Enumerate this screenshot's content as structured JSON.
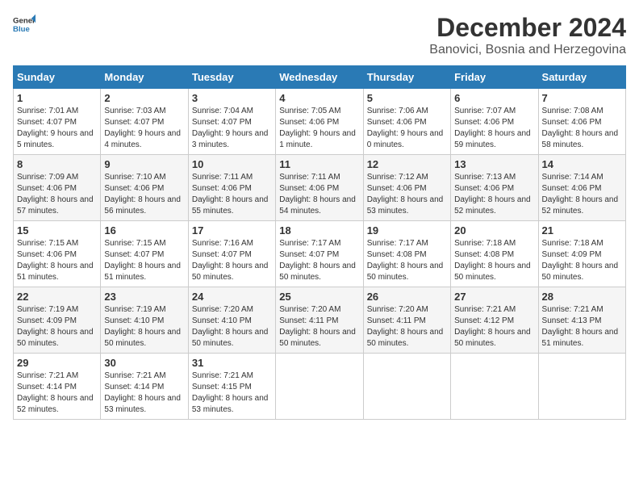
{
  "logo": {
    "general": "General",
    "blue": "Blue"
  },
  "title": "December 2024",
  "location": "Banovici, Bosnia and Herzegovina",
  "days_of_week": [
    "Sunday",
    "Monday",
    "Tuesday",
    "Wednesday",
    "Thursday",
    "Friday",
    "Saturday"
  ],
  "weeks": [
    [
      {
        "day": "1",
        "sunrise": "7:01 AM",
        "sunset": "4:07 PM",
        "daylight": "9 hours and 5 minutes."
      },
      {
        "day": "2",
        "sunrise": "7:03 AM",
        "sunset": "4:07 PM",
        "daylight": "9 hours and 4 minutes."
      },
      {
        "day": "3",
        "sunrise": "7:04 AM",
        "sunset": "4:07 PM",
        "daylight": "9 hours and 3 minutes."
      },
      {
        "day": "4",
        "sunrise": "7:05 AM",
        "sunset": "4:06 PM",
        "daylight": "9 hours and 1 minute."
      },
      {
        "day": "5",
        "sunrise": "7:06 AM",
        "sunset": "4:06 PM",
        "daylight": "9 hours and 0 minutes."
      },
      {
        "day": "6",
        "sunrise": "7:07 AM",
        "sunset": "4:06 PM",
        "daylight": "8 hours and 59 minutes."
      },
      {
        "day": "7",
        "sunrise": "7:08 AM",
        "sunset": "4:06 PM",
        "daylight": "8 hours and 58 minutes."
      }
    ],
    [
      {
        "day": "8",
        "sunrise": "7:09 AM",
        "sunset": "4:06 PM",
        "daylight": "8 hours and 57 minutes."
      },
      {
        "day": "9",
        "sunrise": "7:10 AM",
        "sunset": "4:06 PM",
        "daylight": "8 hours and 56 minutes."
      },
      {
        "day": "10",
        "sunrise": "7:11 AM",
        "sunset": "4:06 PM",
        "daylight": "8 hours and 55 minutes."
      },
      {
        "day": "11",
        "sunrise": "7:11 AM",
        "sunset": "4:06 PM",
        "daylight": "8 hours and 54 minutes."
      },
      {
        "day": "12",
        "sunrise": "7:12 AM",
        "sunset": "4:06 PM",
        "daylight": "8 hours and 53 minutes."
      },
      {
        "day": "13",
        "sunrise": "7:13 AM",
        "sunset": "4:06 PM",
        "daylight": "8 hours and 52 minutes."
      },
      {
        "day": "14",
        "sunrise": "7:14 AM",
        "sunset": "4:06 PM",
        "daylight": "8 hours and 52 minutes."
      }
    ],
    [
      {
        "day": "15",
        "sunrise": "7:15 AM",
        "sunset": "4:06 PM",
        "daylight": "8 hours and 51 minutes."
      },
      {
        "day": "16",
        "sunrise": "7:15 AM",
        "sunset": "4:07 PM",
        "daylight": "8 hours and 51 minutes."
      },
      {
        "day": "17",
        "sunrise": "7:16 AM",
        "sunset": "4:07 PM",
        "daylight": "8 hours and 50 minutes."
      },
      {
        "day": "18",
        "sunrise": "7:17 AM",
        "sunset": "4:07 PM",
        "daylight": "8 hours and 50 minutes."
      },
      {
        "day": "19",
        "sunrise": "7:17 AM",
        "sunset": "4:08 PM",
        "daylight": "8 hours and 50 minutes."
      },
      {
        "day": "20",
        "sunrise": "7:18 AM",
        "sunset": "4:08 PM",
        "daylight": "8 hours and 50 minutes."
      },
      {
        "day": "21",
        "sunrise": "7:18 AM",
        "sunset": "4:09 PM",
        "daylight": "8 hours and 50 minutes."
      }
    ],
    [
      {
        "day": "22",
        "sunrise": "7:19 AM",
        "sunset": "4:09 PM",
        "daylight": "8 hours and 50 minutes."
      },
      {
        "day": "23",
        "sunrise": "7:19 AM",
        "sunset": "4:10 PM",
        "daylight": "8 hours and 50 minutes."
      },
      {
        "day": "24",
        "sunrise": "7:20 AM",
        "sunset": "4:10 PM",
        "daylight": "8 hours and 50 minutes."
      },
      {
        "day": "25",
        "sunrise": "7:20 AM",
        "sunset": "4:11 PM",
        "daylight": "8 hours and 50 minutes."
      },
      {
        "day": "26",
        "sunrise": "7:20 AM",
        "sunset": "4:11 PM",
        "daylight": "8 hours and 50 minutes."
      },
      {
        "day": "27",
        "sunrise": "7:21 AM",
        "sunset": "4:12 PM",
        "daylight": "8 hours and 50 minutes."
      },
      {
        "day": "28",
        "sunrise": "7:21 AM",
        "sunset": "4:13 PM",
        "daylight": "8 hours and 51 minutes."
      }
    ],
    [
      {
        "day": "29",
        "sunrise": "7:21 AM",
        "sunset": "4:14 PM",
        "daylight": "8 hours and 52 minutes."
      },
      {
        "day": "30",
        "sunrise": "7:21 AM",
        "sunset": "4:14 PM",
        "daylight": "8 hours and 53 minutes."
      },
      {
        "day": "31",
        "sunrise": "7:21 AM",
        "sunset": "4:15 PM",
        "daylight": "8 hours and 53 minutes."
      },
      null,
      null,
      null,
      null
    ]
  ],
  "label_sunrise": "Sunrise:",
  "label_sunset": "Sunset:",
  "label_daylight": "Daylight:"
}
